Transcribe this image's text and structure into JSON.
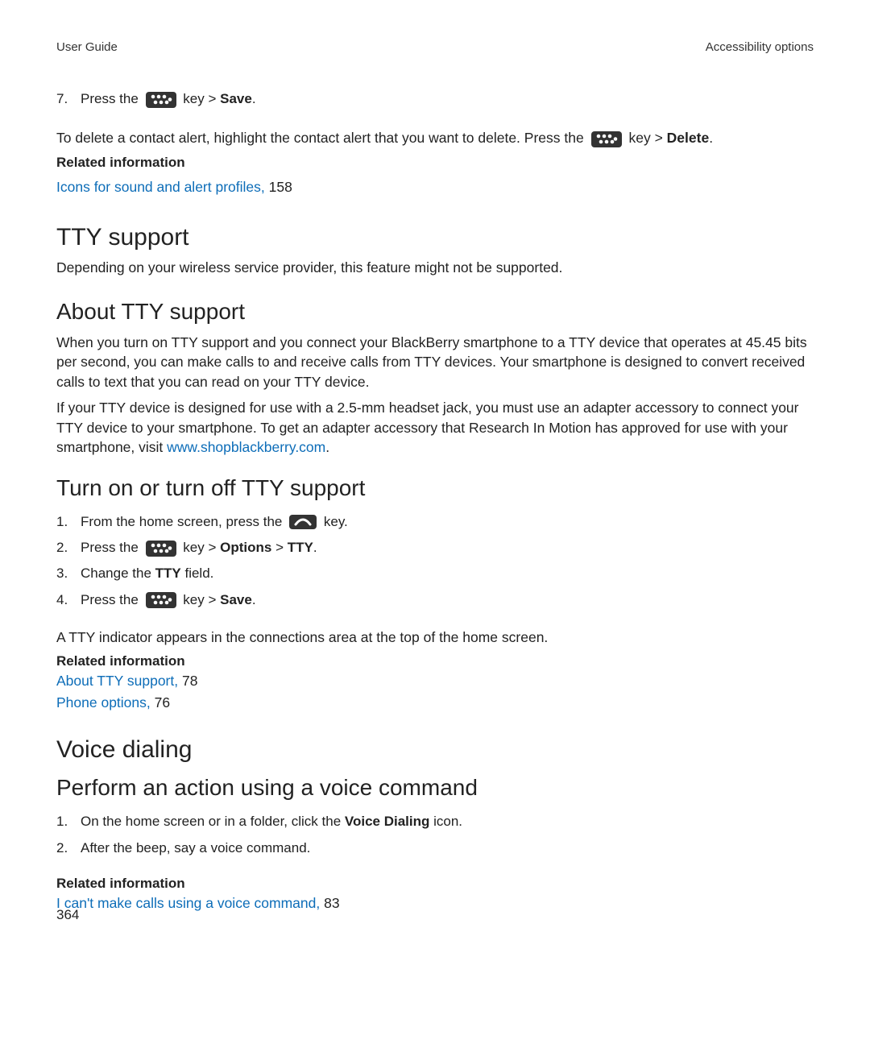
{
  "header": {
    "left": "User Guide",
    "right": "Accessibility options"
  },
  "step7": {
    "num": "7.",
    "pre": "Press the",
    "post_key": " key > ",
    "save": "Save",
    "period": "."
  },
  "delete_para": {
    "pre": "To delete a contact alert, highlight the contact alert that you want to delete. Press the",
    "post_key": " key > ",
    "delete": "Delete",
    "period": "."
  },
  "related1": {
    "heading": "Related information",
    "link": "Icons for sound and alert profiles,",
    "page": " 158"
  },
  "tty": {
    "heading": "TTY support",
    "intro": "Depending on your wireless service provider, this feature might not be supported.",
    "about_heading": "About TTY support",
    "about_p1": "When you turn on TTY support and you connect your BlackBerry smartphone to a TTY device that operates at 45.45 bits per second, you can make calls to and receive calls from TTY devices. Your smartphone is designed to convert received calls to text that you can read on your TTY device.",
    "about_p2_pre": "If your TTY device is designed for use with a 2.5-mm headset jack, you must use an adapter accessory to connect your TTY device to your smartphone. To get an adapter accessory that Research In Motion has approved for use with your smartphone, visit ",
    "about_p2_link": "www.shopblackberry.com",
    "about_p2_post": ".",
    "turn_heading": "Turn on or turn off TTY support",
    "steps": {
      "1": {
        "num": "1.",
        "pre": "From the home screen, press the",
        "post": " key."
      },
      "2": {
        "num": "2.",
        "pre": "Press the",
        "mid": " key > ",
        "opt": "Options",
        "gt": " > ",
        "tty": "TTY",
        "period": "."
      },
      "3": {
        "num": "3.",
        "pre": "Change the ",
        "tty": "TTY",
        "post": " field."
      },
      "4": {
        "num": "4.",
        "pre": "Press the",
        "mid": " key > ",
        "save": "Save",
        "period": "."
      }
    },
    "indicator": "A TTY indicator appears in the connections area at the top of the home screen.",
    "related": {
      "heading": "Related information",
      "link1": "About TTY support,",
      "page1": " 78",
      "link2": "Phone options,",
      "page2": " 76"
    }
  },
  "voice": {
    "heading": "Voice dialing",
    "sub": "Perform an action using a voice command",
    "steps": {
      "1": {
        "num": "1.",
        "pre": "On the home screen or in a folder, click the ",
        "vd": "Voice Dialing",
        "post": " icon."
      },
      "2": {
        "num": "2.",
        "text": "After the beep, say a voice command."
      }
    },
    "related": {
      "heading": "Related information",
      "link": "I can't make calls using a voice command,",
      "page": " 83"
    }
  },
  "page_number": "364"
}
